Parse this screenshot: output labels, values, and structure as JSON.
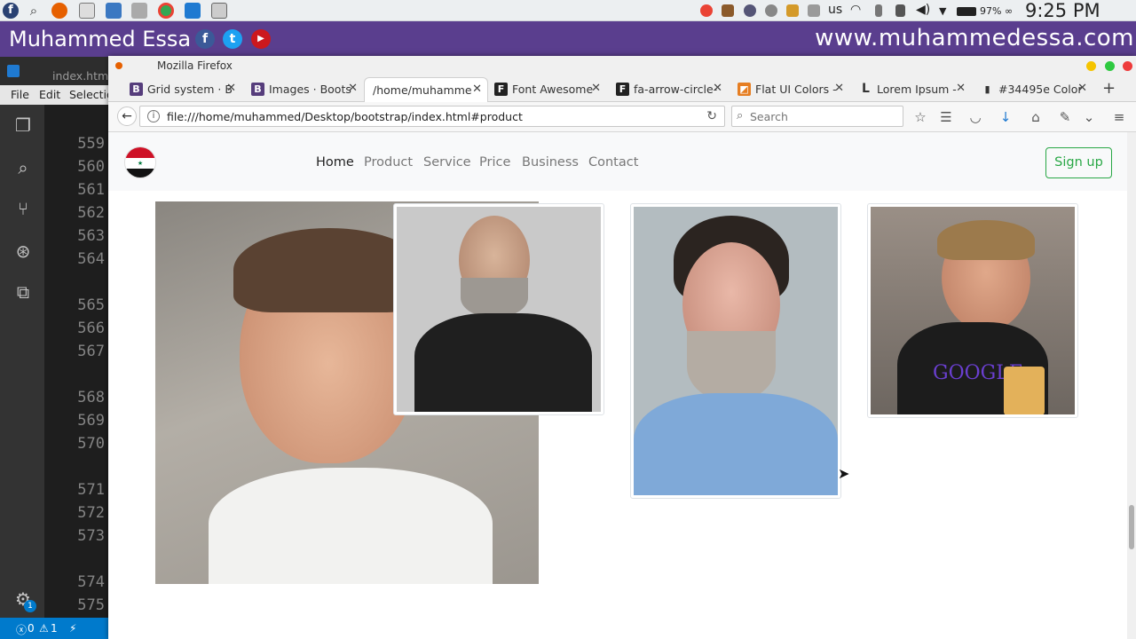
{
  "system_panel": {
    "keyboard_layout": "us",
    "battery": "97% ∞",
    "clock": "9:25 PM"
  },
  "banner": {
    "name": "Muhammed Essa",
    "site": "www.muhammedessa.com",
    "social": [
      "f",
      "t",
      "▶"
    ]
  },
  "vscode": {
    "tab": "index.html",
    "menu": [
      "File",
      "Edit",
      "Selection"
    ],
    "line_numbers": [
      "559",
      "560",
      "561",
      "562",
      "563",
      "564",
      "565",
      "566",
      "567",
      "568",
      "569",
      "570",
      "571",
      "572",
      "573",
      "574",
      "575"
    ],
    "status": {
      "errors": "0",
      "warnings": "1",
      "settings_badge": "1"
    }
  },
  "firefox": {
    "title": "Mozilla Firefox",
    "tabs": [
      {
        "label": "Grid system · B",
        "favicon": "B",
        "color": "#563d7c"
      },
      {
        "label": "Images · Boots",
        "favicon": "B",
        "color": "#563d7c"
      },
      {
        "label": "/home/muhamme",
        "favicon": "",
        "color": "#ffffff"
      },
      {
        "label": "Font Awesome",
        "favicon": "F",
        "color": "#222222"
      },
      {
        "label": "fa-arrow-circle-",
        "favicon": "F",
        "color": "#222222"
      },
      {
        "label": "Flat UI Colors -",
        "favicon": "◩",
        "color": "#e67e22"
      },
      {
        "label": "Lorem Ipsum -",
        "favicon": "L",
        "color": "#ffffff"
      },
      {
        "label": "#34495e Color",
        "favicon": "▮",
        "color": "#ffffff"
      }
    ],
    "url": "file:///home/muhammed/Desktop/bootstrap/index.html#product",
    "search_placeholder": "Search"
  },
  "page": {
    "nav": [
      "Home",
      "Product",
      "Service",
      "Price",
      "Business",
      "Contact"
    ],
    "signup": "Sign up",
    "overlay_shirt_text": "GOOGLE",
    "accent_color": "#28a745"
  }
}
